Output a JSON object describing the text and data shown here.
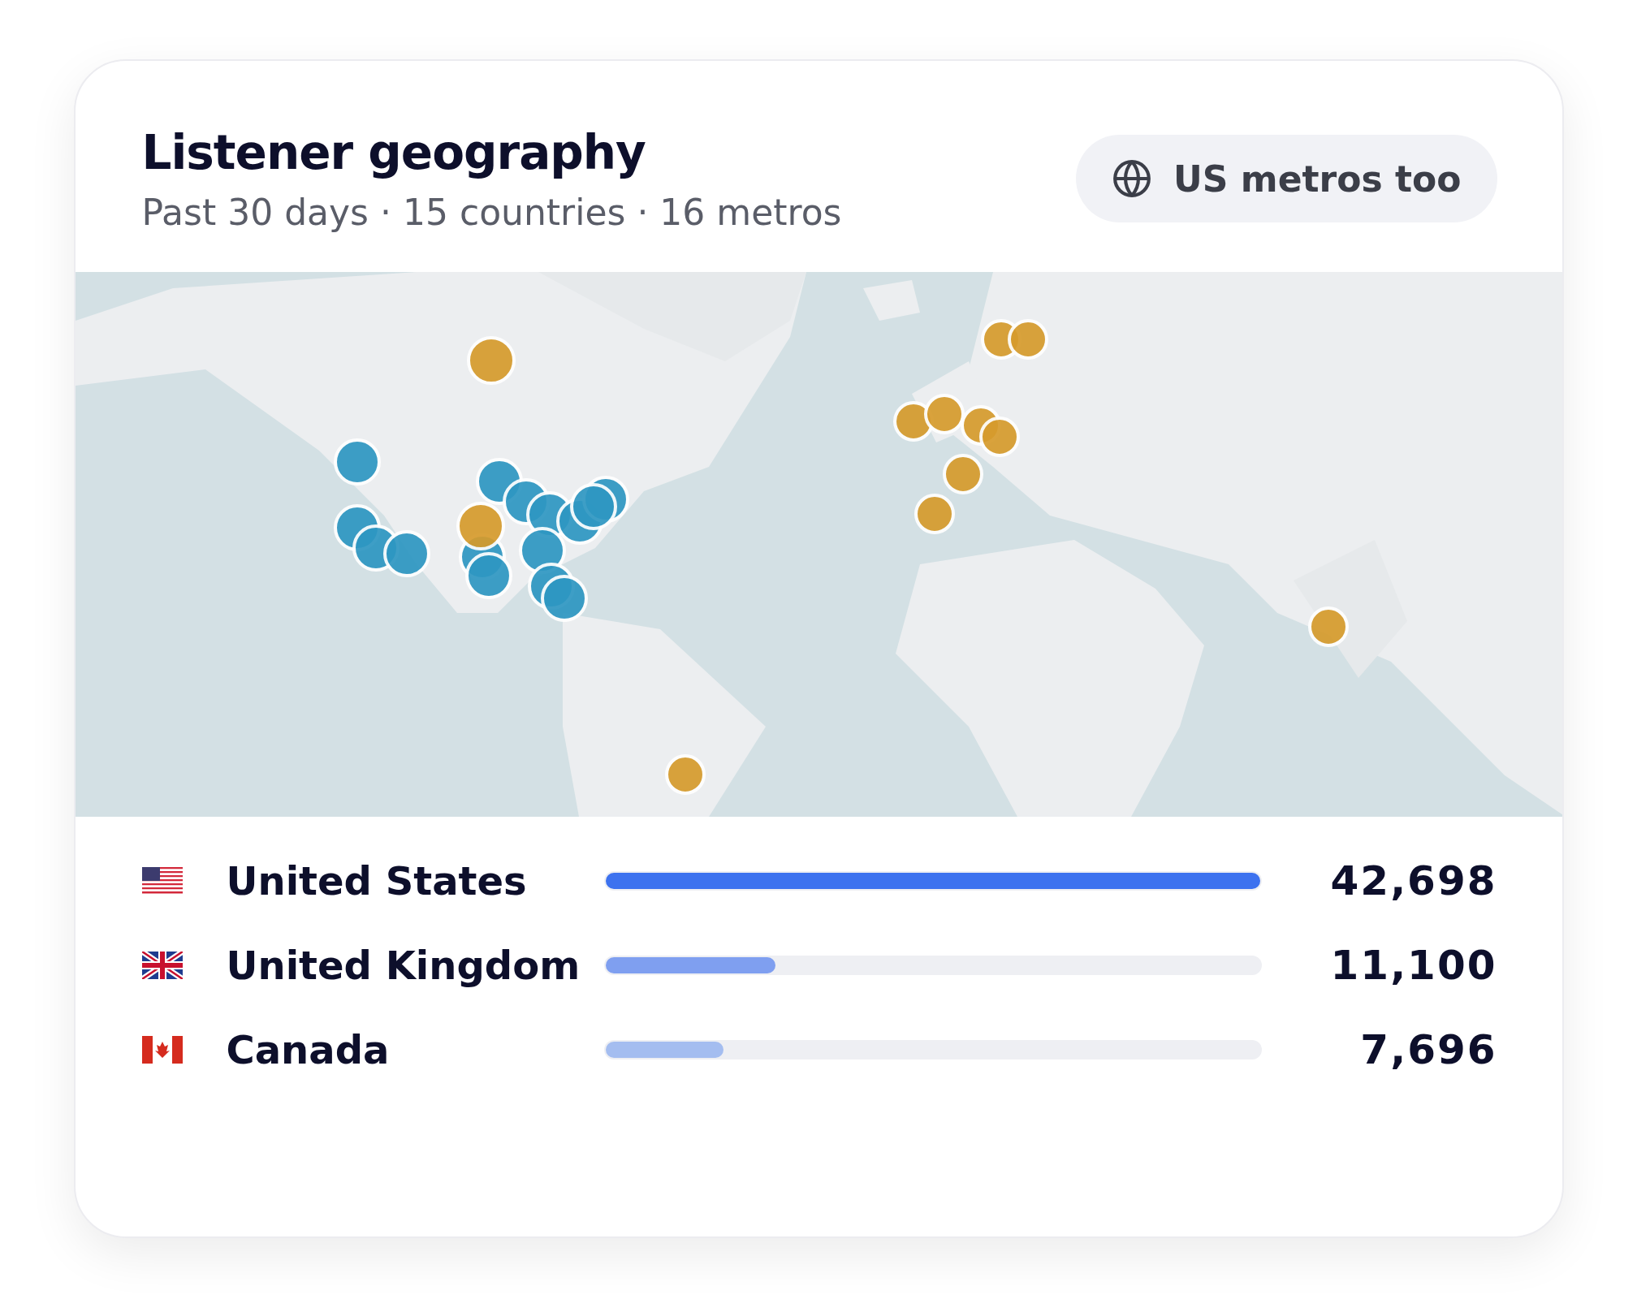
{
  "header": {
    "title": "Listener geography",
    "subtitle": "Past 30 days · 15 countries · 16 metros",
    "toggle": {
      "label": "US metros too"
    }
  },
  "countries": [
    {
      "kind": "us",
      "name": "United States",
      "level": 1,
      "color": "#3d72ef",
      "count": "42,698"
    },
    {
      "kind": "gb",
      "name": "United Kingdom",
      "level": 0.26,
      "color": "#7f9ff0",
      "count": "11,100"
    },
    {
      "kind": "ca",
      "name": "Canada",
      "level": 0.18,
      "color": "#a4bdf0",
      "count": "7,696"
    }
  ]
}
